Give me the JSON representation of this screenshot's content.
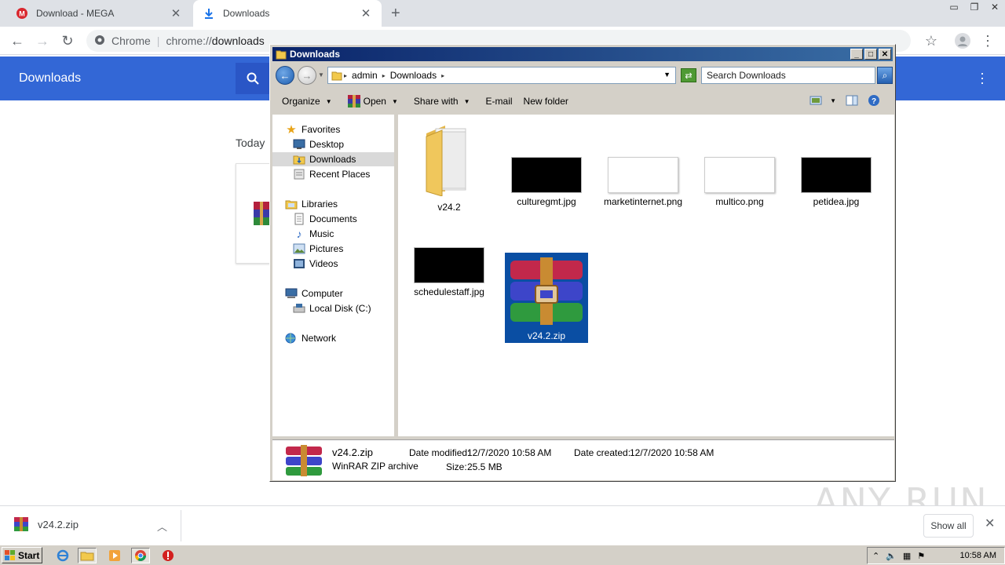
{
  "browser": {
    "tabs": [
      {
        "title": "Download - MEGA",
        "icon": "mega-icon",
        "active": false
      },
      {
        "title": "Downloads",
        "icon": "download-icon",
        "active": true
      }
    ],
    "new_tab": "+",
    "omnibox": {
      "label": "Chrome",
      "scheme": "chrome://",
      "path": "downloads"
    }
  },
  "downloads_page": {
    "title": "Downloads",
    "section": "Today"
  },
  "shelf": {
    "file": "v24.2.zip",
    "show_all": "Show all"
  },
  "explorer": {
    "title": "Downloads",
    "address": [
      "admin",
      "Downloads"
    ],
    "search_placeholder": "Search Downloads",
    "commands": [
      "Organize",
      "Open",
      "Share with",
      "E-mail",
      "New folder"
    ],
    "nav": {
      "favorites": {
        "label": "Favorites",
        "items": [
          "Desktop",
          "Downloads",
          "Recent Places"
        ]
      },
      "libraries": {
        "label": "Libraries",
        "items": [
          "Documents",
          "Music",
          "Pictures",
          "Videos"
        ]
      },
      "computer": {
        "label": "Computer",
        "items": [
          "Local Disk (C:)"
        ]
      },
      "network": {
        "label": "Network"
      }
    },
    "files": [
      {
        "name": "v24.2",
        "kind": "folder"
      },
      {
        "name": "culturegmt.jpg",
        "kind": "dark-image"
      },
      {
        "name": "marketinternet.png",
        "kind": "light-image"
      },
      {
        "name": "multico.png",
        "kind": "light-image"
      },
      {
        "name": "petidea.jpg",
        "kind": "dark-image"
      },
      {
        "name": "schedulestaff.jpg",
        "kind": "dark-image"
      },
      {
        "name": "v24.2.zip",
        "kind": "winrar",
        "selected": true
      }
    ],
    "details": {
      "name": "v24.2.zip",
      "type": "WinRAR ZIP archive",
      "modified_label": "Date modified:",
      "modified": "12/7/2020 10:58 AM",
      "created_label": "Date created:",
      "created": "12/7/2020 10:58 AM",
      "size_label": "Size:",
      "size": "25.5 MB"
    }
  },
  "taskbar": {
    "start": "Start",
    "clock": "10:58 AM"
  },
  "watermark": "ANY RUN",
  "colors": {
    "chrome_blue": "#3367d6",
    "xp_title": "#0a246a",
    "selection": "#0a4ea3"
  }
}
